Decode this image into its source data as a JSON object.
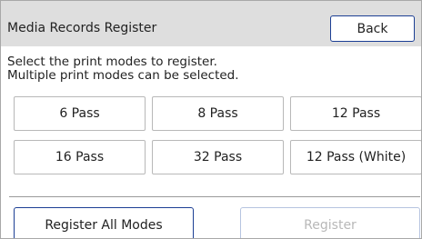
{
  "header": {
    "title": "Media Records Register",
    "back_label": "Back"
  },
  "instruction": {
    "line1": "Select the print modes to register.",
    "line2": "Multiple print modes can be selected."
  },
  "modes": [
    {
      "label": "6 Pass"
    },
    {
      "label": "8 Pass"
    },
    {
      "label": "12 Pass"
    },
    {
      "label": "16 Pass"
    },
    {
      "label": "32 Pass"
    },
    {
      "label": "12 Pass (White)"
    }
  ],
  "footer": {
    "register_all_label": "Register All Modes",
    "register_label": "Register",
    "register_enabled": false
  },
  "colors": {
    "header_bg": "#dedede",
    "accent_border": "#1c3f94",
    "disabled_text": "#b8b8b8"
  }
}
